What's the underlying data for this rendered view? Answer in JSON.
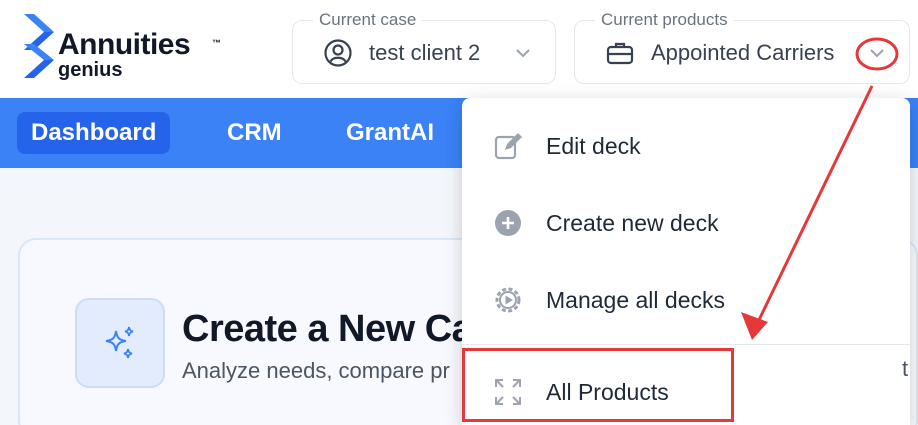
{
  "brand": {
    "name": "Annuities",
    "tm": "™",
    "sub": "genius",
    "color": "#3b82f6"
  },
  "case_selector": {
    "legend": "Current case",
    "value": "test client 2",
    "icon": "user-circle-icon"
  },
  "products_selector": {
    "legend": "Current products",
    "value": "Appointed Carriers",
    "icon": "briefcase-icon"
  },
  "nav": {
    "items": [
      {
        "label": "Dashboard",
        "active": true
      },
      {
        "label": "CRM",
        "active": false
      },
      {
        "label": "GrantAI",
        "active": false
      }
    ]
  },
  "card": {
    "title": "Create a New Ca",
    "subtitle": "Analyze needs, compare pr",
    "icon": "sparkles-icon"
  },
  "dropdown": {
    "items": [
      {
        "label": "Edit deck",
        "icon": "edit-icon"
      },
      {
        "label": "Create new deck",
        "icon": "plus-circle-icon"
      },
      {
        "label": "Manage all decks",
        "icon": "gear-play-icon"
      },
      {
        "label": "All Products",
        "icon": "expand-icon"
      }
    ],
    "overflow_text": "t"
  },
  "colors": {
    "accent": "#3b82f6",
    "accent_active": "#2563eb",
    "annotation": "#e5383b"
  }
}
